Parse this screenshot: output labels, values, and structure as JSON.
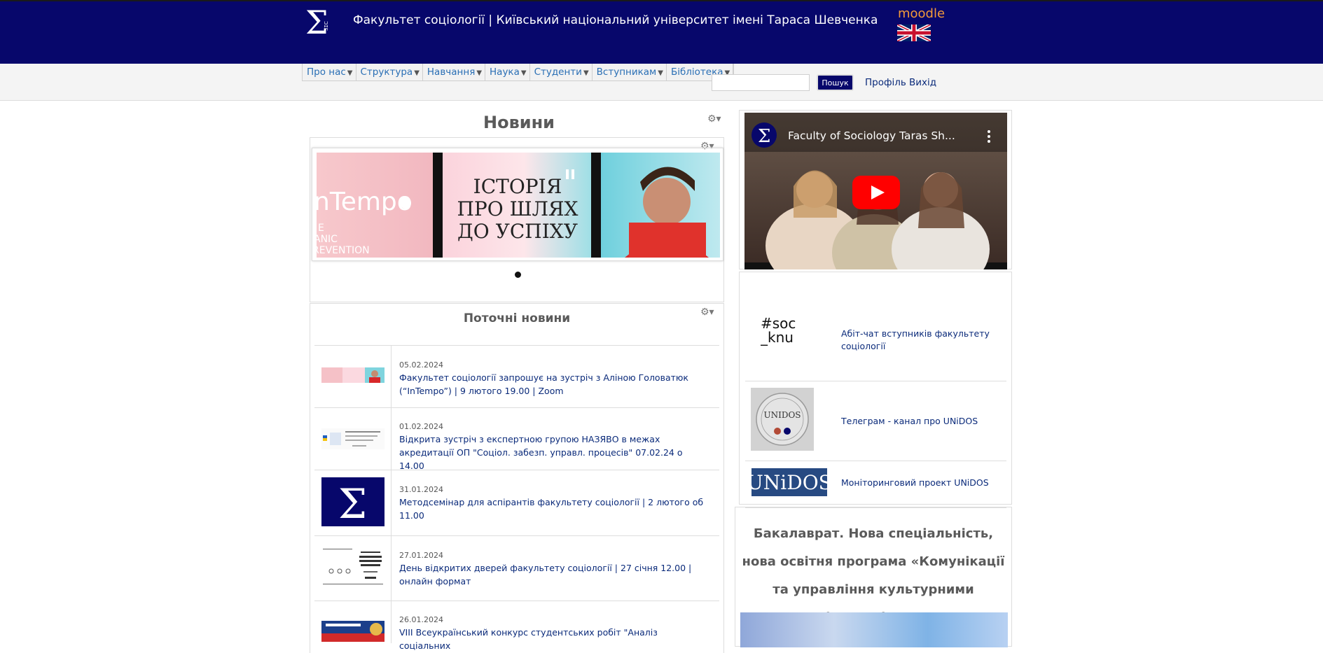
{
  "header": {
    "logo_label": "SΣC",
    "title": "Факультет соціології | Київський національний університет імені Тараса Шевченка",
    "moodle_label": "moodle",
    "language_flag": "uk-flag-icon"
  },
  "nav": {
    "items": [
      {
        "label": "Про нас"
      },
      {
        "label": "Структура"
      },
      {
        "label": "Навчання"
      },
      {
        "label": "Наука"
      },
      {
        "label": "Студенти"
      },
      {
        "label": "Вступникам"
      },
      {
        "label": "Бібліотека"
      }
    ],
    "search_value": "",
    "search_button": "Пошук",
    "profile_link": "Профіль",
    "logout_link": "Вихід"
  },
  "main": {
    "heading": "Новини",
    "slider": {
      "slide_text_line1": "ІСТОРІЯ",
      "slide_text_line2": "ПРО ШЛЯХ",
      "slide_text_line3": "ДО УСПІХУ",
      "slide_left_text": "nTempo",
      "slide_small_1": "E",
      "slide_small_2": "ANIC",
      "slide_small_3": "REVENTION"
    },
    "current_news_title": "Поточні новини",
    "news": [
      {
        "date": "05.02.2024",
        "title": "Факультет соціології запрошує на зустріч з Аліною Головатюк (“InTempo”) | 9 лютого 19.00 | Zoom"
      },
      {
        "date": "01.02.2024",
        "title": "Відкрита зустріч з експертною групою НАЗЯВО в межах акредитації ОП \"Соціол. забезп. управл. процесів\" 07.02.24 о 14.00"
      },
      {
        "date": "31.01.2024",
        "title": "Методсемінар для аспірантів факультету соціології | 2 лютого об 11.00"
      },
      {
        "date": "27.01.2024",
        "title": "День відкритих дверей факультету соціології | 27 січня 12.00 | онлайн формат"
      },
      {
        "date": "26.01.2024",
        "title": "VIII Всеукраїнський конкурс студентських робіт \"Аналіз соціальних"
      }
    ]
  },
  "sidebar": {
    "video_title": "Faculty of Sociology Taras Sh...",
    "links": [
      {
        "logo_text": "#soc_knu",
        "label": "Абіт-чат вступників факультету соціології"
      },
      {
        "logo_text": "UNIDOS",
        "label": "Телеграм - канал про UNiDOS"
      },
      {
        "logo_text": "UNiDOS",
        "label": "Моніторинговий проект UNiDOS"
      }
    ],
    "program_title": "Бакалаврат. Нова спеціальність, нова освітня програма «Комунікації та управління культурними індустріями»"
  },
  "colors": {
    "header_bg": "#07076b",
    "moodle": "#f39a3a",
    "link": "#0a2a7a",
    "menu_link": "#2a6fb5"
  }
}
